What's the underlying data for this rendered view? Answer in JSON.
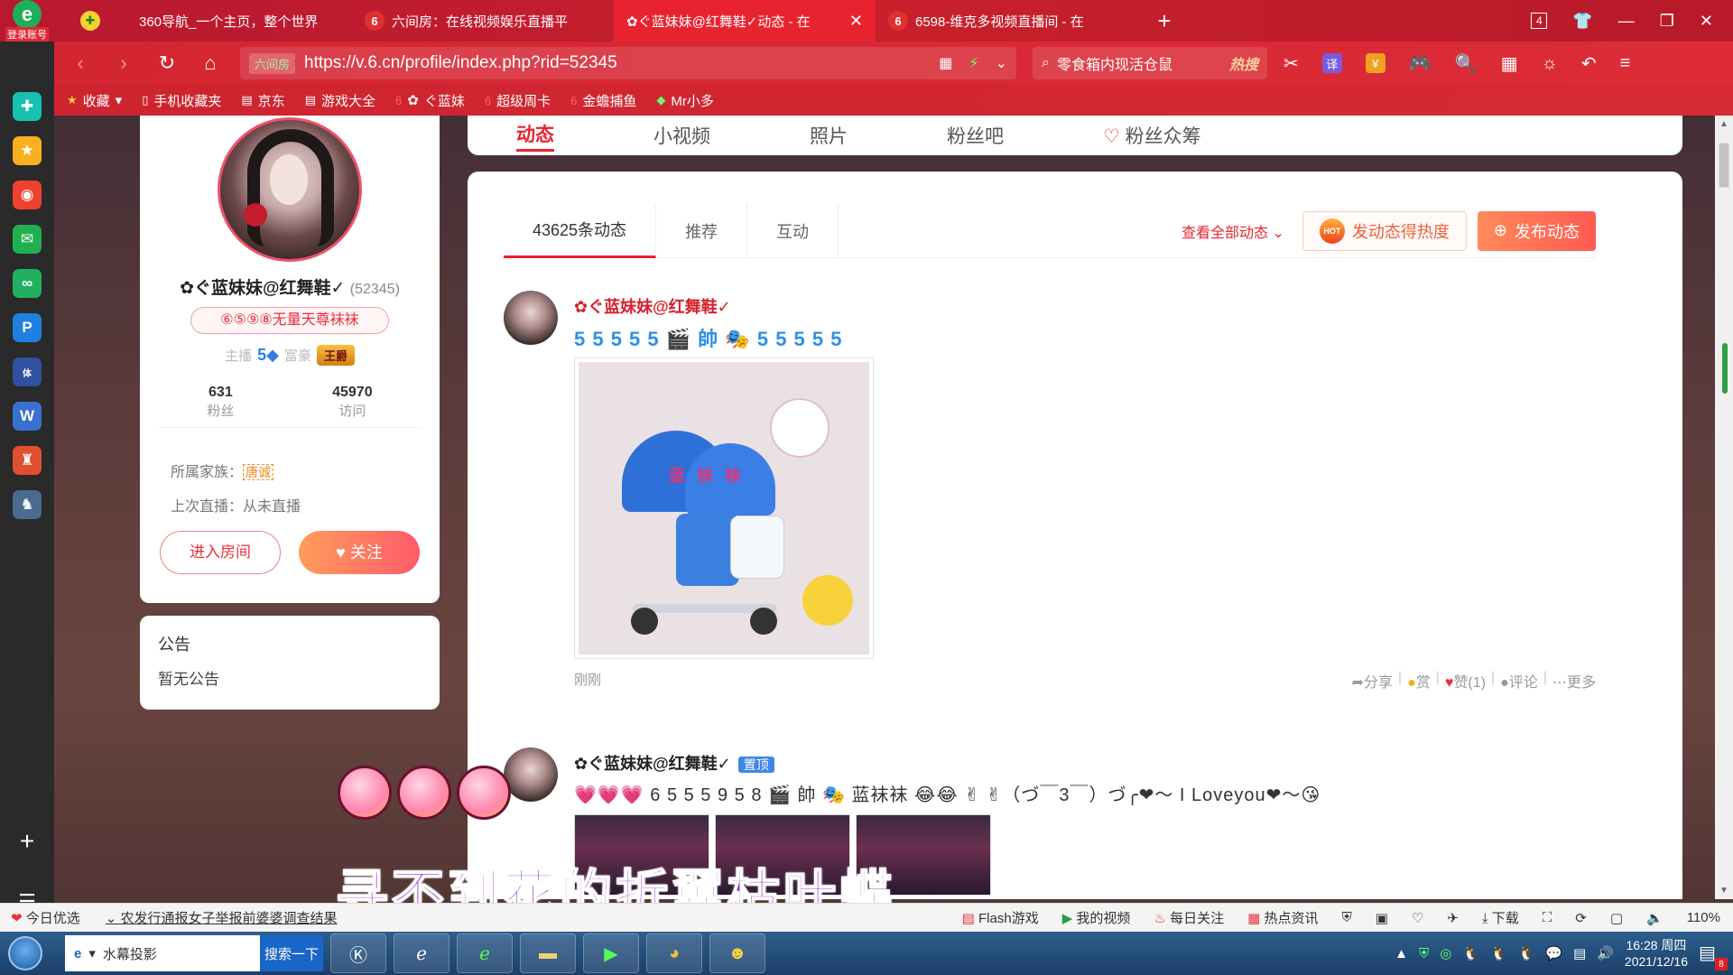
{
  "browser": {
    "login_label": "登录账号",
    "tabs": [
      {
        "title": "360导航_一个主页，整个世界",
        "active": false
      },
      {
        "title": "六间房：在线视频娱乐直播平",
        "active": false
      },
      {
        "title": "✿ぐ蓝妹妹@红舞鞋✓动态 - 在",
        "active": true
      },
      {
        "title": "6598-维克多视频直播间 - 在",
        "active": false
      }
    ],
    "new_tab": "+",
    "tab_count": "4",
    "url_site_tag": "六间房",
    "url": "https://v.6.cn/profile/index.php?rid=52345",
    "search_text": "零食箱内现活仓鼠",
    "search_hot": "热搜",
    "bookmarks": [
      "收藏",
      "手机收藏夹",
      "京东",
      "游戏大全",
      "ぐ蓝妹",
      "超级周卡",
      "金蟾捕鱼",
      "Mr小多"
    ]
  },
  "nav_tabs": [
    "动态",
    "小视频",
    "照片",
    "粉丝吧",
    "粉丝众筹"
  ],
  "profile": {
    "name": "✿ぐ蓝妹妹@红舞鞋✓",
    "rid": "(52345)",
    "family_badge": "⑥⑤⑨⑧无量天尊袜袜",
    "anchor_label": "主播",
    "anchor_level": "5",
    "rich_label": "富豪",
    "rich_badge": "王爵",
    "fans_count": "631",
    "fans_label": "粉丝",
    "visits_count": "45970",
    "visits_label": "访问",
    "family_label": "所属家族：",
    "family_name": "唐诚",
    "last_live": "上次直播：从未直播",
    "enter_room": "进入房间",
    "follow": "关注"
  },
  "notice": {
    "title": "公告",
    "content": "暂无公告"
  },
  "feed": {
    "tabs": [
      "43625条动态",
      "推荐",
      "互动"
    ],
    "view_all": "查看全部动态",
    "hot_button": "发动态得热度",
    "hot_badge": "HOT",
    "post_button": "发布动态",
    "posts": [
      {
        "author": "✿ぐ蓝妹妹@红舞鞋✓",
        "content": "5 5 5 5 5 🎬 帥 🎭 5 5 5 5 5",
        "image_text": "蓝 袜 袜",
        "time": "刚刚",
        "actions": [
          "分享",
          "赏",
          "赞(1)",
          "评论",
          "更多"
        ]
      },
      {
        "author": "✿ぐ蓝妹妹@红舞鞋✓",
        "pinned": "置顶",
        "content": "💗💗💗 6 5 5 5 9 5 8 🎬 帥 🎭 蓝袜袜 😂😂 ✌ ✌（づ￣3￣）づ╭❤～ I Loveyou❤～😘"
      }
    ]
  },
  "overlay_subtitle": "寻不到花的折翼枯叶蝶",
  "statusbar": {
    "today": "今日优选",
    "news": "农发行通报女子举报前婆婆调查结果",
    "items": [
      "Flash游戏",
      "我的视频",
      "每日关注",
      "热点资讯",
      "下载"
    ],
    "zoom": "110%"
  },
  "taskbar": {
    "search_text": "水幕投影",
    "search_button": "搜索一下",
    "time": "16:28 周四",
    "date": "2021/12/16",
    "notify_count": "8"
  },
  "colors": {
    "brand_red": "#e8232f",
    "anchor_blue": "#2f7fe6",
    "follow_gradient_start": "#ff9d5a",
    "follow_gradient_end": "#ff5a6a",
    "subtitle_purple": "#8c2cd8"
  }
}
